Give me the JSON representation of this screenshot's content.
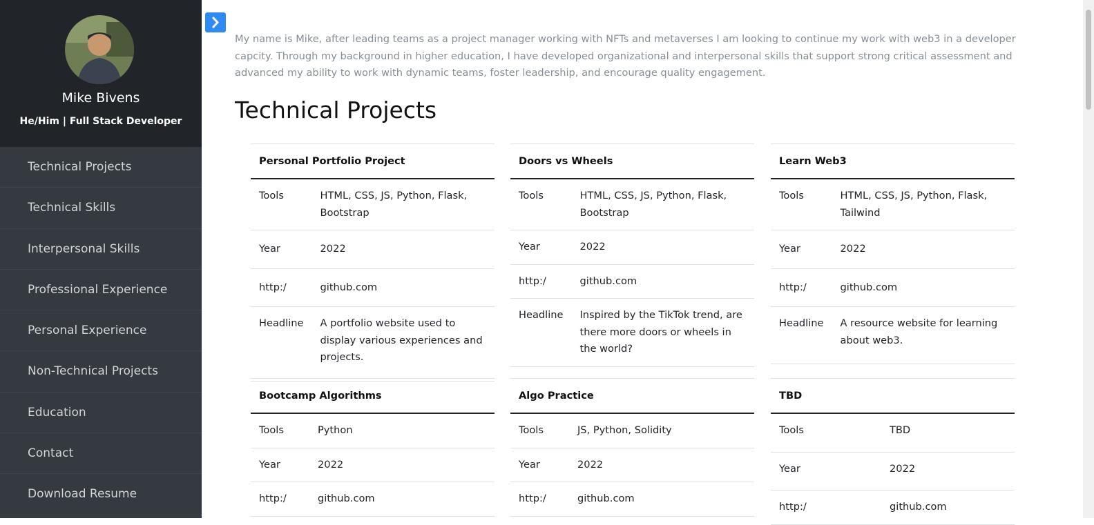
{
  "sidebar": {
    "name": "Mike Bivens",
    "subtitle": "He/Him | Full Stack Developer",
    "nav": [
      "Technical Projects",
      "Technical Skills",
      "Interpersonal Skills",
      "Professional Experience",
      "Personal Experience",
      "Non-Technical Projects",
      "Education",
      "Contact",
      "Download Resume"
    ]
  },
  "main": {
    "intro": "My name is Mike, after leading teams as a project manager working with NFTs and metaverses I am looking to continue my work with web3 in a developer capcity. Through my background in higher education, I have developed organizational and interpersonal skills that support strong critical assessment and advanced my ability to work with dynamic teams, foster leadership, and encourage quality engagement.",
    "section_title": "Technical Projects",
    "projects": [
      {
        "title": "Personal Portfolio Project",
        "rows": [
          [
            "Tools",
            "HTML, CSS, JS, Python, Flask, Bootstrap"
          ],
          [
            "Year",
            "2022"
          ],
          [
            "http:/",
            "github.com"
          ],
          [
            "Headline",
            "A portfolio website used to display various experiences and projects."
          ]
        ]
      },
      {
        "title": "Doors vs Wheels",
        "rows": [
          [
            "Tools",
            "HTML, CSS, JS, Python, Flask, Bootstrap"
          ],
          [
            "Year",
            "2022"
          ],
          [
            "http:/",
            "github.com"
          ],
          [
            "Headline",
            "Inspired by the TikTok trend, are there more doors or wheels in the world?"
          ]
        ]
      },
      {
        "title": "Learn Web3",
        "rows": [
          [
            "Tools",
            "HTML, CSS, JS, Python, Flask, Tailwind"
          ],
          [
            "Year",
            "2022"
          ],
          [
            "http:/",
            "github.com"
          ],
          [
            "Headline",
            "A resource website for learning about web3."
          ]
        ]
      },
      {
        "title": "Bootcamp Algorithms",
        "rows": [
          [
            "Tools",
            "Python"
          ],
          [
            "Year",
            "2022"
          ],
          [
            "http:/",
            "github.com"
          ]
        ]
      },
      {
        "title": "Algo Practice",
        "rows": [
          [
            "Tools",
            "JS, Python, Solidity"
          ],
          [
            "Year",
            "2022"
          ],
          [
            "http:/",
            "github.com"
          ]
        ]
      },
      {
        "title": "TBD",
        "rows": [
          [
            "Tools",
            "TBD"
          ],
          [
            "Year",
            "2022"
          ],
          [
            "http:/",
            "github.com"
          ]
        ]
      }
    ]
  },
  "colors": {
    "sidebar_bg": "#343a40",
    "profile_bg": "#212529",
    "accent": "#2f8bf3"
  }
}
